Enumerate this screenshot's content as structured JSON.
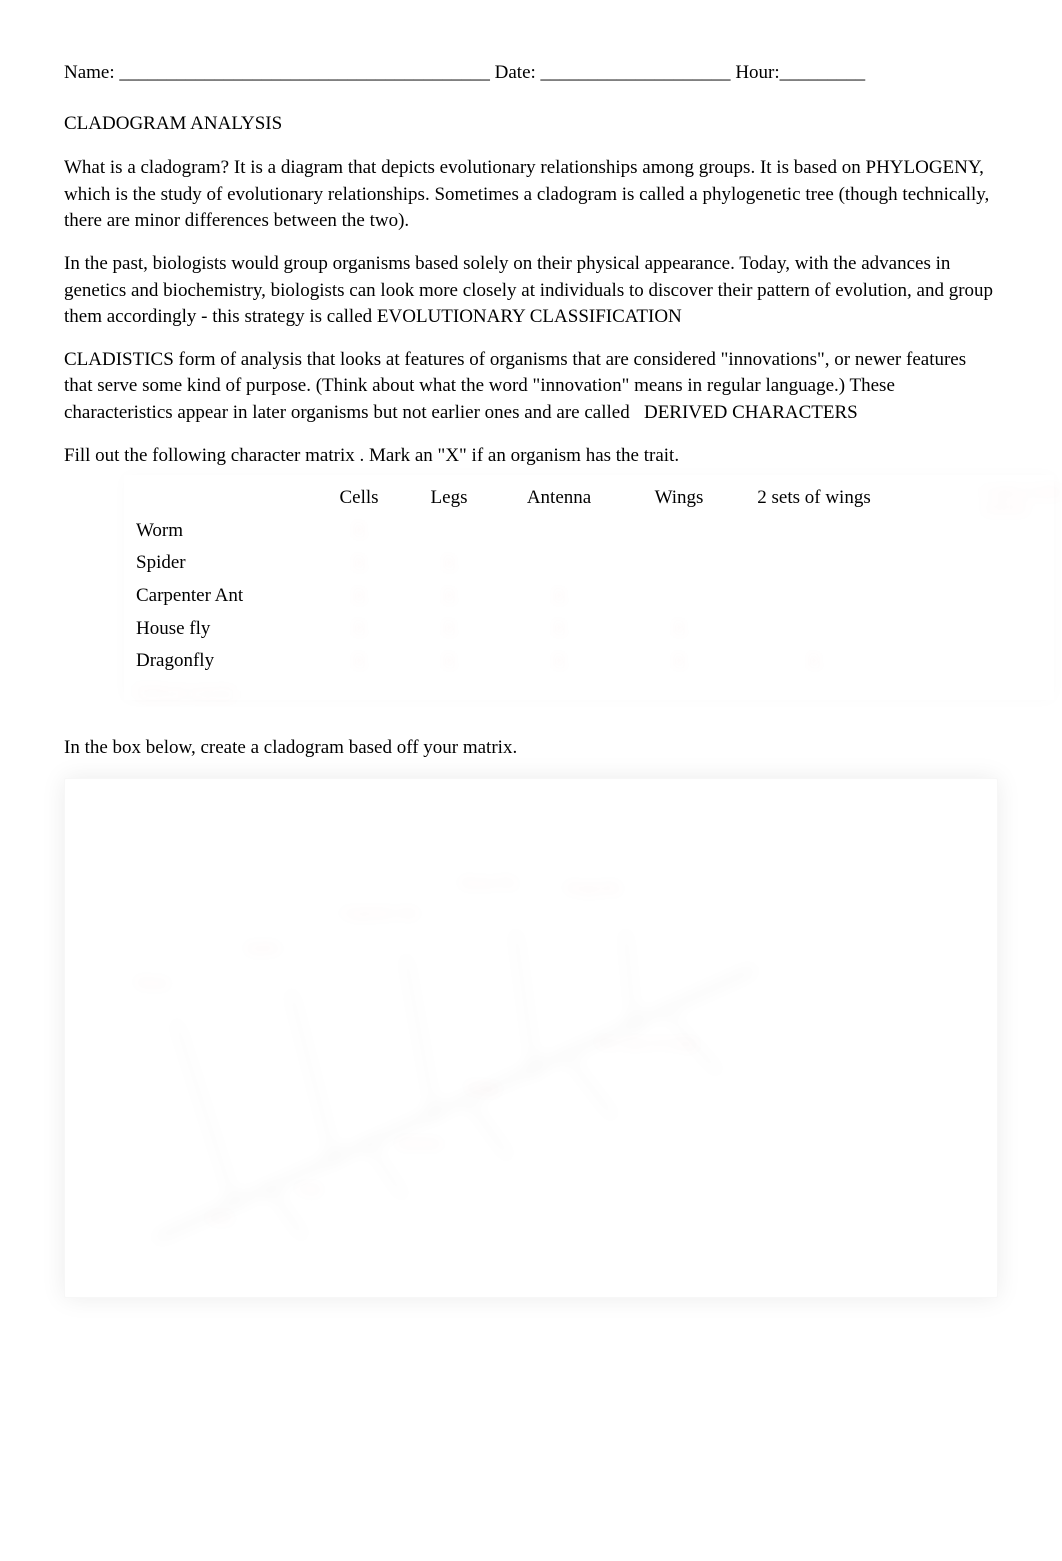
{
  "header": {
    "name_label": "Name: _______________________________________",
    "date_label": "Date: ____________________",
    "hour_label": "Hour:_________"
  },
  "title": "CLADOGRAM ANALYSIS",
  "para1_a": "What is a cladogram? It is a diagram that depicts evolutionary relationships among groups. It is based on ",
  "para1_key": "PHYLOGENY",
  "para1_b": ", which is the study of evolutionary relationships. Sometimes a cladogram is called a phylogenetic tree (though technically, there are minor differences between the two).",
  "para2_a": "In the past, biologists would group organisms based solely on their physical appearance. Today, with the advances in genetics and biochemistry, biologists can look more closely at individuals to discover their pattern of evolution, and group them accordingly - this strategy is called ",
  "para2_key": "EVOLUTIONARY CLASSIFICATION",
  "para3_key": "CLADISTICS",
  "para3_a": " form of analysis that looks at features of organisms that are considered \"innovations\", or newer features that serve some kind of purpose. (Think about what the word \"innovation\" means in regular language.) These characteristics appear in later organisms but not earlier ones and are called ",
  "para3_key2": "DERIVED CHARACTERS",
  "instr1": "Fill out the following character matrix       . Mark an \"X\" if an organism has the trait.",
  "matrix": {
    "headers": [
      "Cells",
      "Legs",
      "Antenna",
      "Wings",
      "2 sets of wings"
    ],
    "rows": [
      "Worm",
      "Spider",
      "Carpenter Ant",
      "House fly",
      "Dragonfly"
    ],
    "data": [
      [
        "X",
        "",
        "",
        "",
        ""
      ],
      [
        "X",
        "X",
        "",
        "",
        ""
      ],
      [
        "X",
        "X",
        "X",
        "",
        ""
      ],
      [
        "X",
        "X",
        "X",
        "X",
        ""
      ],
      [
        "X",
        "X",
        "X",
        "X",
        "X"
      ]
    ],
    "extra_row_hidden": "Velvet worm",
    "side_hidden": "Legless/califa animals"
  },
  "instr2": "In the box below, create a cladogram based off your matrix.",
  "cladogram": {
    "branch_labels": [
      "Worm",
      "Spider",
      "Carpenter Ant",
      "House Fly",
      "Dragonfly"
    ],
    "trait_labels": [
      "Cells",
      "Legs",
      "Antenna",
      "Wings",
      "Two Sets of wings"
    ]
  }
}
